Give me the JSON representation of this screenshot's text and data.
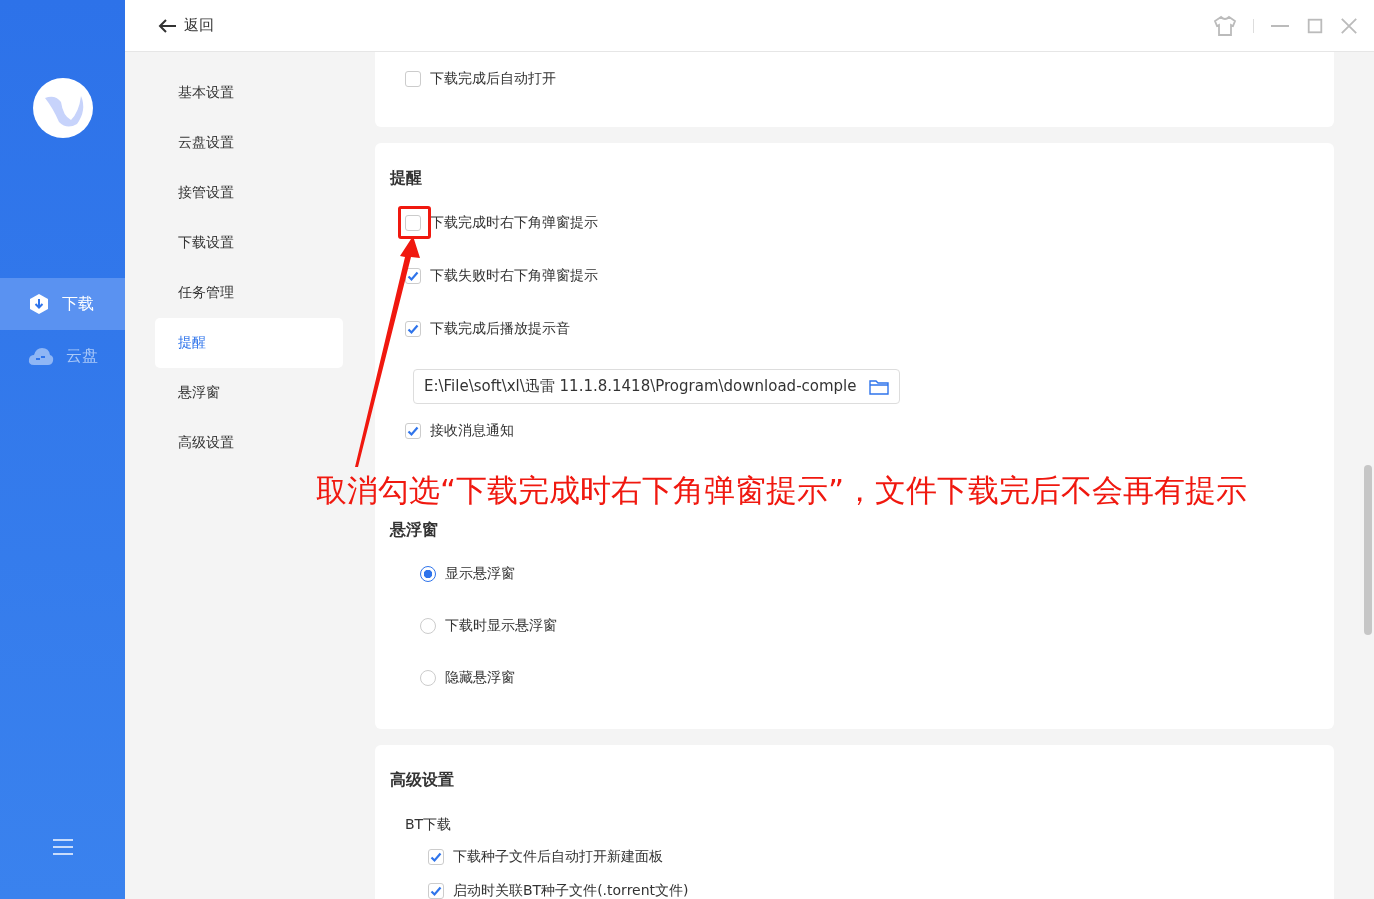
{
  "window": {
    "back_label": "返回"
  },
  "app_nav": [
    {
      "label": "下载",
      "selected": true
    },
    {
      "label": "云盘",
      "selected": false
    }
  ],
  "settings_nav": [
    {
      "label": "基本设置",
      "selected": false
    },
    {
      "label": "云盘设置",
      "selected": false
    },
    {
      "label": "接管设置",
      "selected": false
    },
    {
      "label": "下载设置",
      "selected": false
    },
    {
      "label": "任务管理",
      "selected": false
    },
    {
      "label": "提醒",
      "selected": true
    },
    {
      "label": "悬浮窗",
      "selected": false
    },
    {
      "label": "高级设置",
      "selected": false
    }
  ],
  "cards": [
    {
      "groups": [
        {
          "items": [
            {
              "kind": "checkbox",
              "label": "下载完成后自动打开",
              "checked": false
            }
          ]
        }
      ]
    },
    {
      "groups": [
        {
          "title": "提醒",
          "items": [
            {
              "kind": "checkbox",
              "label": "下载完成时右下角弹窗提示",
              "checked": false
            },
            {
              "kind": "checkbox",
              "label": "下载失败时右下角弹窗提示",
              "checked": true
            },
            {
              "kind": "checkbox",
              "label": "下载完成后播放提示音",
              "checked": true
            },
            {
              "kind": "path_field",
              "value": "E:\\File\\soft\\xl\\迅雷 11.1.8.1418\\Program\\download-comple"
            },
            {
              "kind": "checkbox",
              "label": "接收消息通知",
              "checked": true
            }
          ]
        },
        {
          "title": "悬浮窗",
          "items": [
            {
              "kind": "radio",
              "label": "显示悬浮窗",
              "selected": true
            },
            {
              "kind": "radio",
              "label": "下载时显示悬浮窗",
              "selected": false
            },
            {
              "kind": "radio",
              "label": "隐藏悬浮窗",
              "selected": false
            }
          ]
        }
      ]
    },
    {
      "groups": [
        {
          "title": "高级设置",
          "items": [
            {
              "kind": "subheading",
              "label": "BT下载",
              "children": [
                {
                  "kind": "checkbox",
                  "label": "下载种子文件后自动打开新建面板",
                  "checked": true
                },
                {
                  "kind": "checkbox",
                  "label": "启动时关联BT种子文件(.torrent文件)",
                  "checked": true
                }
              ]
            }
          ]
        }
      ]
    }
  ],
  "annotation": {
    "text": "取消勾选“下载完成时右下角弹窗提示”，文件下载完后不会再有提示"
  }
}
